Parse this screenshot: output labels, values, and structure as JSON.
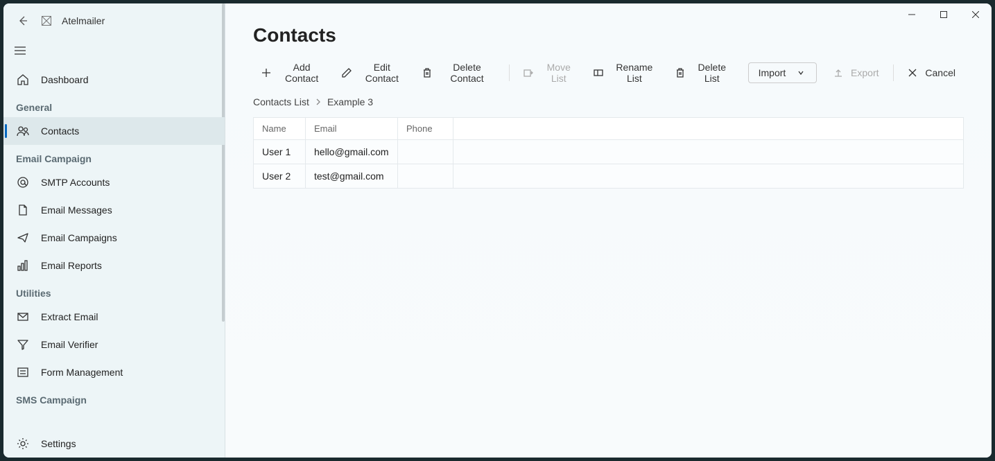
{
  "app": {
    "title": "Atelmailer"
  },
  "sidebar": {
    "dashboard": "Dashboard",
    "sections": {
      "general": "General",
      "emailCampaign": "Email Campaign",
      "utilities": "Utilities",
      "smsCampaign": "SMS Campaign"
    },
    "items": {
      "contacts": "Contacts",
      "smtpAccounts": "SMTP Accounts",
      "emailMessages": "Email Messages",
      "emailCampaigns": "Email Campaigns",
      "emailReports": "Email Reports",
      "extractEmail": "Extract Email",
      "emailVerifier": "Email Verifier",
      "formManagement": "Form Management",
      "settings": "Settings"
    }
  },
  "page": {
    "title": "Contacts"
  },
  "toolbar": {
    "addContact": "Add Contact",
    "editContact": "Edit Contact",
    "deleteContact": "Delete Contact",
    "moveList": "Move List",
    "renameList": "Rename List",
    "deleteList": "Delete List",
    "import": "Import",
    "export": "Export",
    "cancel": "Cancel"
  },
  "breadcrumb": {
    "root": "Contacts List",
    "current": "Example 3"
  },
  "table": {
    "headers": {
      "name": "Name",
      "email": "Email",
      "phone": "Phone"
    },
    "rows": [
      {
        "name": "User 1",
        "email": "hello@gmail.com",
        "phone": ""
      },
      {
        "name": "User 2",
        "email": "test@gmail.com",
        "phone": ""
      }
    ]
  }
}
